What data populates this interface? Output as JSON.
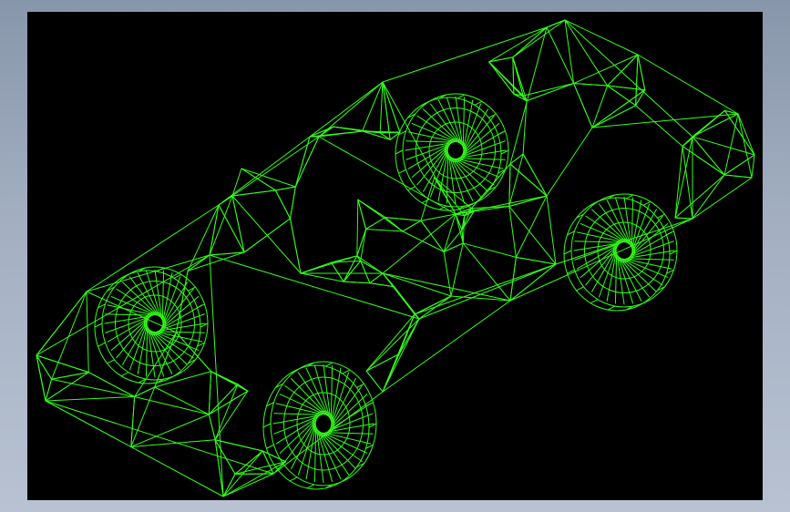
{
  "viewport": {
    "background": "#000000",
    "wire_color": "#33ff1a",
    "frame_gradient_top": "#8896ab",
    "frame_gradient_bottom": "#b8c2d2"
  },
  "model": {
    "icon": "car-wireframe-icon",
    "wheels": [
      "wheel-rear-left",
      "wheel-rear-right",
      "wheel-front-left",
      "wheel-front-right"
    ]
  }
}
